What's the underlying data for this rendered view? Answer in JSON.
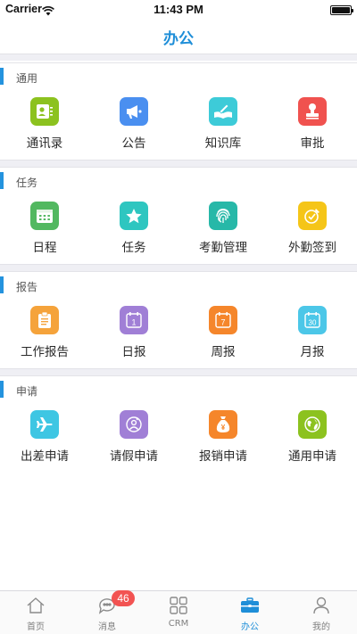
{
  "status_bar": {
    "carrier": "Carrier",
    "time": "11:43 PM"
  },
  "header": {
    "title": "办公"
  },
  "sections": [
    {
      "title": "通用",
      "items": [
        {
          "label": "通讯录",
          "icon": "contacts-icon",
          "color": "#8cc21f"
        },
        {
          "label": "公告",
          "icon": "megaphone-icon",
          "color": "#4a8ff0"
        },
        {
          "label": "知识库",
          "icon": "book-icon",
          "color": "#3dcbd8"
        },
        {
          "label": "审批",
          "icon": "stamp-icon",
          "color": "#f0524f"
        }
      ]
    },
    {
      "title": "任务",
      "items": [
        {
          "label": "日程",
          "icon": "calendar-grid-icon",
          "color": "#52b860"
        },
        {
          "label": "任务",
          "icon": "star-icon",
          "color": "#2ec6c0"
        },
        {
          "label": "考勤管理",
          "icon": "fingerprint-icon",
          "color": "#27b8a8"
        },
        {
          "label": "外勤签到",
          "icon": "signin-icon",
          "color": "#f5c518"
        }
      ]
    },
    {
      "title": "报告",
      "items": [
        {
          "label": "工作报告",
          "icon": "clipboard-icon",
          "color": "#f5a33b"
        },
        {
          "label": "日报",
          "icon": "calendar-day-icon",
          "color": "#a07fd6",
          "num": "1"
        },
        {
          "label": "周报",
          "icon": "calendar-week-icon",
          "color": "#f5862b",
          "num": "7"
        },
        {
          "label": "月报",
          "icon": "calendar-month-icon",
          "color": "#4cc7e8",
          "num": "30"
        }
      ]
    },
    {
      "title": "申请",
      "items": [
        {
          "label": "出差申请",
          "icon": "airplane-icon",
          "color": "#3ec6e3"
        },
        {
          "label": "请假申请",
          "icon": "leave-clock-icon",
          "color": "#a07fd6"
        },
        {
          "label": "报销申请",
          "icon": "money-bag-icon",
          "color": "#f5862b"
        },
        {
          "label": "通用申请",
          "icon": "globe-icon",
          "color": "#8cc21f"
        }
      ]
    }
  ],
  "tab_bar": {
    "tabs": [
      {
        "label": "首页",
        "icon": "home-icon"
      },
      {
        "label": "消息",
        "icon": "chat-icon",
        "badge": "46"
      },
      {
        "label": "CRM",
        "icon": "grid-icon"
      },
      {
        "label": "办公",
        "icon": "briefcase-icon",
        "active": true
      },
      {
        "label": "我的",
        "icon": "person-icon"
      }
    ]
  }
}
